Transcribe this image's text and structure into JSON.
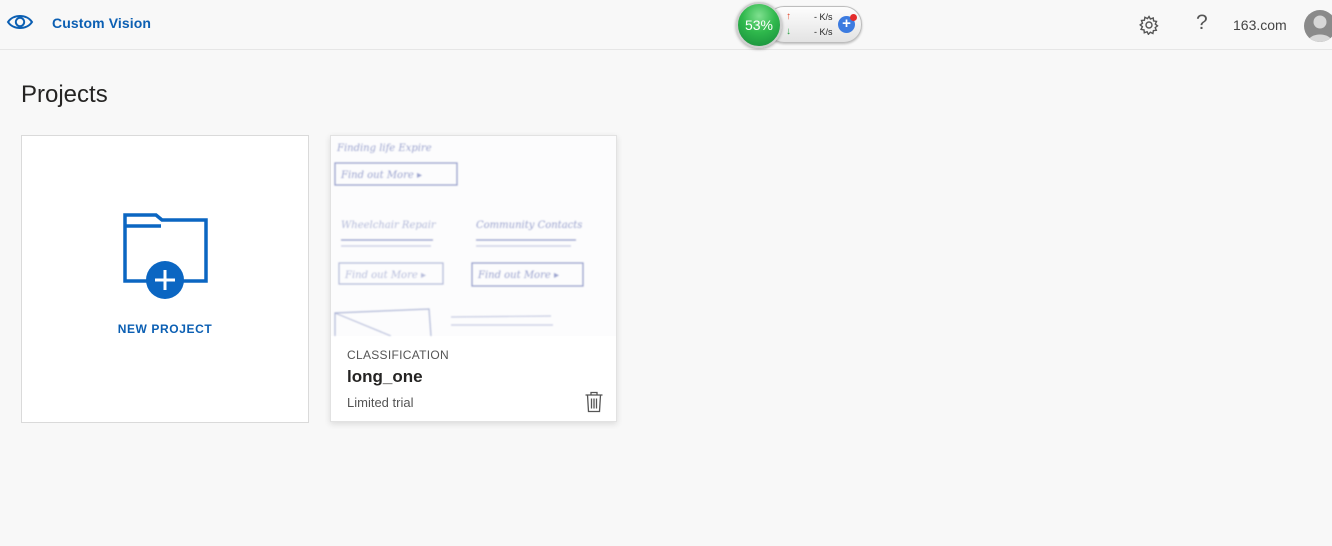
{
  "header": {
    "app_name": "Custom Vision",
    "account": "163.com",
    "brand_color": "#0b5fb3",
    "icons": [
      "eye-icon",
      "gear-icon",
      "help-icon",
      "avatar"
    ]
  },
  "net_monitor": {
    "percent": "53%",
    "upload_rate": "- K/s",
    "download_rate": "- K/s",
    "up_arrow": "↑",
    "down_arrow": "↓",
    "plus": "+"
  },
  "main": {
    "title": "Projects",
    "new_project_label": "NEW PROJECT",
    "projects": [
      {
        "type": "CLASSIFICATION",
        "name": "long_one",
        "status": "Limited trial",
        "thumb_texts": [
          "Finding life Expire",
          "Find out More ▸",
          "Wheelchair Repair",
          "Community Contacts",
          "Find out More ▸",
          "Find out More ▸"
        ]
      }
    ]
  }
}
